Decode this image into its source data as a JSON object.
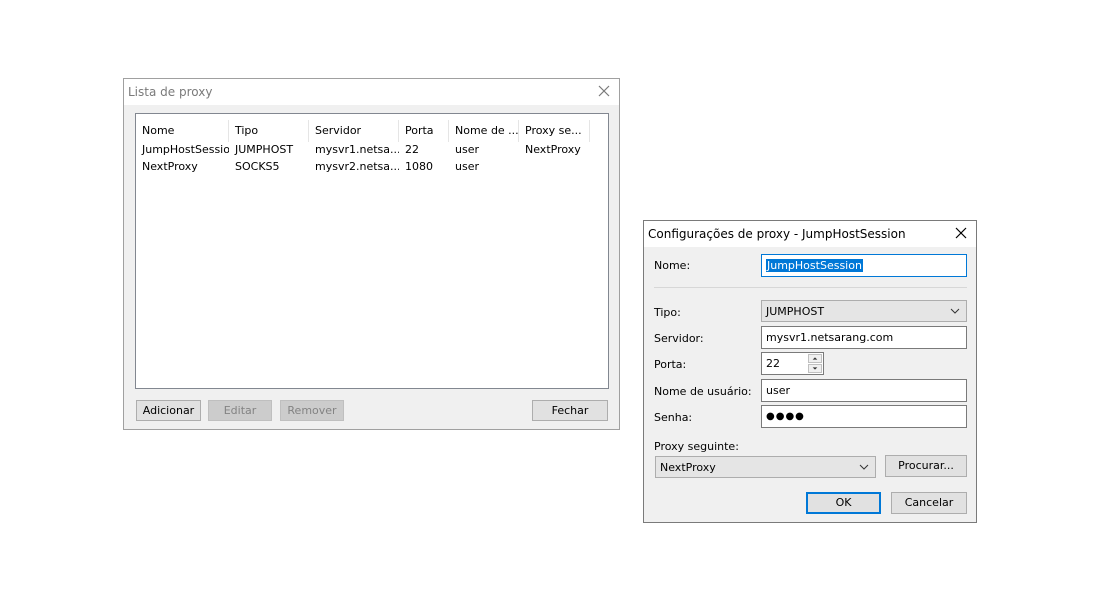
{
  "proxy_list": {
    "title": "Lista de proxy",
    "columns": [
      "Nome",
      "Tipo",
      "Servidor",
      "Porta",
      "Nome de ...",
      "Proxy se..."
    ],
    "rows": [
      [
        "JumpHostSession",
        "JUMPHOST",
        "mysvr1.netsa...",
        "22",
        "user",
        "NextProxy"
      ],
      [
        "NextProxy",
        "SOCKS5",
        "mysvr2.netsa...",
        "1080",
        "user",
        ""
      ]
    ],
    "buttons": {
      "add": "Adicionar",
      "edit": "Editar",
      "remove": "Remover",
      "close": "Fechar"
    }
  },
  "proxy_settings": {
    "title": "Configurações de proxy - JumpHostSession",
    "name_label": "Nome:",
    "name_value": "JumpHostSession",
    "type_label": "Tipo:",
    "type_value": "JUMPHOST",
    "server_label": "Servidor:",
    "server_value": "mysvr1.netsarang.com",
    "port_label": "Porta:",
    "port_value": "22",
    "username_label": "Nome de usuário:",
    "username_value": "user",
    "password_label": "Senha:",
    "password_value": "●●●●",
    "next_proxy_label": "Proxy seguinte:",
    "next_proxy_value": "NextProxy",
    "browse_button": "Procurar...",
    "ok_button": "OK",
    "cancel_button": "Cancelar"
  }
}
